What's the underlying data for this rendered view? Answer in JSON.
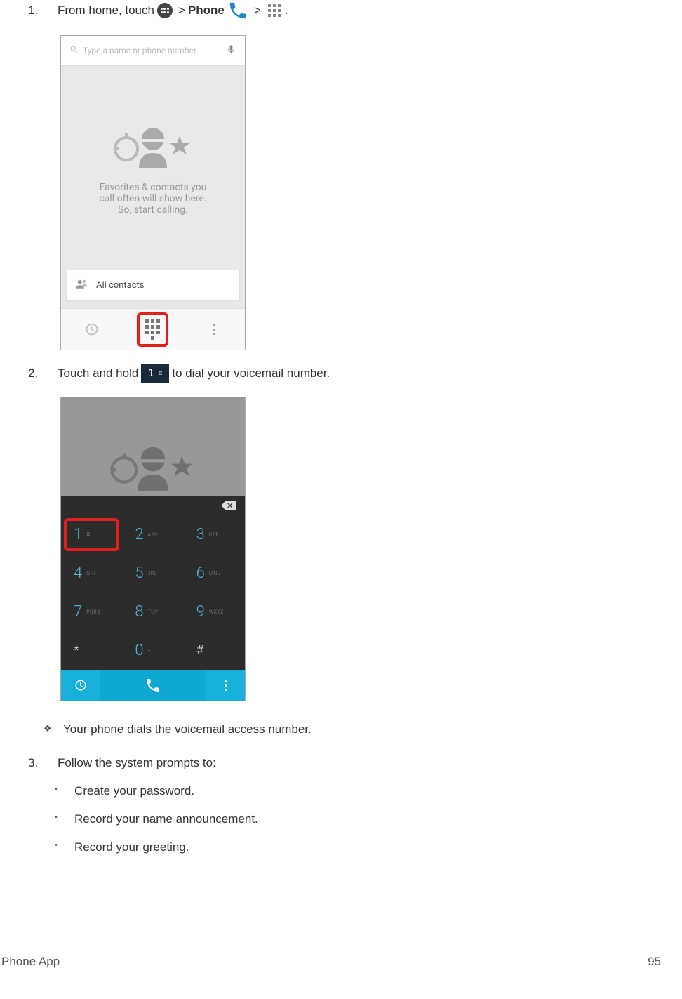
{
  "steps": {
    "s1": {
      "num": "1.",
      "t1": "From home, touch",
      "gt1": ">",
      "phone": "Phone",
      "gt2": ">",
      "period": "."
    },
    "s2": {
      "num": "2.",
      "t1": "Touch and hold",
      "t2": "to dial your voicemail number."
    },
    "s3": {
      "num": "3.",
      "t1": "Follow the system prompts to:"
    }
  },
  "shot1": {
    "search_placeholder": "Type a name or phone number",
    "empty_line1": "Favorites & contacts you",
    "empty_line2": "call often will show here.",
    "empty_line3": "So, start calling.",
    "allcontacts": "All contacts"
  },
  "shot2": {
    "keys": {
      "k1": {
        "n": "1",
        "s": ""
      },
      "k2": {
        "n": "2",
        "s": "ABC"
      },
      "k3": {
        "n": "3",
        "s": "DEF"
      },
      "k4": {
        "n": "4",
        "s": "GHI"
      },
      "k5": {
        "n": "5",
        "s": "JKL"
      },
      "k6": {
        "n": "6",
        "s": "MNO"
      },
      "k7": {
        "n": "7",
        "s": "PQRS"
      },
      "k8": {
        "n": "8",
        "s": "TUV"
      },
      "k9": {
        "n": "9",
        "s": "WXYZ"
      },
      "kstar": {
        "n": "*",
        "s": ""
      },
      "k0": {
        "n": "0",
        "s": "+"
      },
      "khash": {
        "n": "#",
        "s": ""
      }
    }
  },
  "result": {
    "r1": "Your phone dials the voicemail access number."
  },
  "prompts": {
    "p1": "Create your password.",
    "p2": "Record your name announcement.",
    "p3": "Record your greeting."
  },
  "footer": {
    "left": "Phone App",
    "right": "95"
  }
}
